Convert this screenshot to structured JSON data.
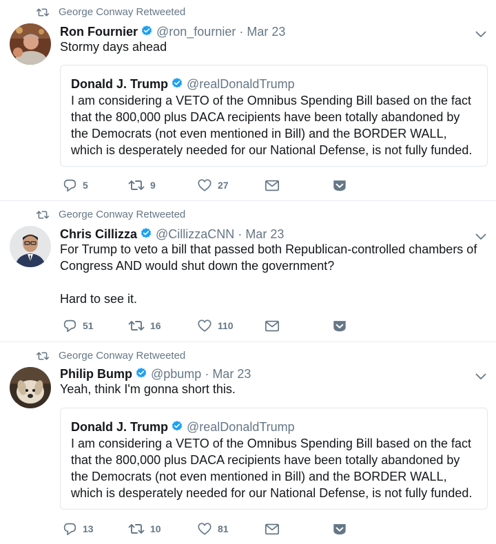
{
  "tweets": [
    {
      "retweeted_by": "George Conway Retweeted",
      "name": "Ron Fournier",
      "handle": "@ron_fournier",
      "date": "Mar 23",
      "text": "Stormy days ahead",
      "quote": {
        "name": "Donald J. Trump",
        "handle": "@realDonaldTrump",
        "text": "I am considering a VETO of the Omnibus Spending Bill based on the fact that the 800,000 plus DACA recipients have been totally abandoned by the Democrats (not even mentioned in Bill) and the BORDER WALL, which is desperately needed for our National Defense, is not fully funded."
      },
      "replies": "5",
      "retweets": "9",
      "likes": "27"
    },
    {
      "retweeted_by": "George Conway Retweeted",
      "name": "Chris Cillizza",
      "handle": "@CillizzaCNN",
      "date": "Mar 23",
      "text": "For Trump to veto a bill that passed both Republican-controlled chambers of Congress AND would shut down the government?\n\nHard to see it.",
      "replies": "51",
      "retweets": "16",
      "likes": "110"
    },
    {
      "retweeted_by": "George Conway Retweeted",
      "name": "Philip Bump",
      "handle": "@pbump",
      "date": "Mar 23",
      "text": "Yeah, think I'm gonna short this.",
      "quote": {
        "name": "Donald J. Trump",
        "handle": "@realDonaldTrump",
        "text": "I am considering a VETO of the Omnibus Spending Bill based on the fact that the 800,000 plus DACA recipients have been totally abandoned by the Democrats (not even mentioned in Bill) and the BORDER WALL, which is desperately needed for our National Defense, is not fully funded."
      },
      "replies": "13",
      "retweets": "10",
      "likes": "81"
    }
  ],
  "colors": {
    "text": "#14171a",
    "secondary": "#657786",
    "verified": "#1da1f2",
    "border": "#e1e8ed"
  },
  "icons": [
    "retweet-icon",
    "verified-badge-icon",
    "chevron-down-icon",
    "reply-icon",
    "like-icon",
    "message-icon",
    "save-icon"
  ]
}
